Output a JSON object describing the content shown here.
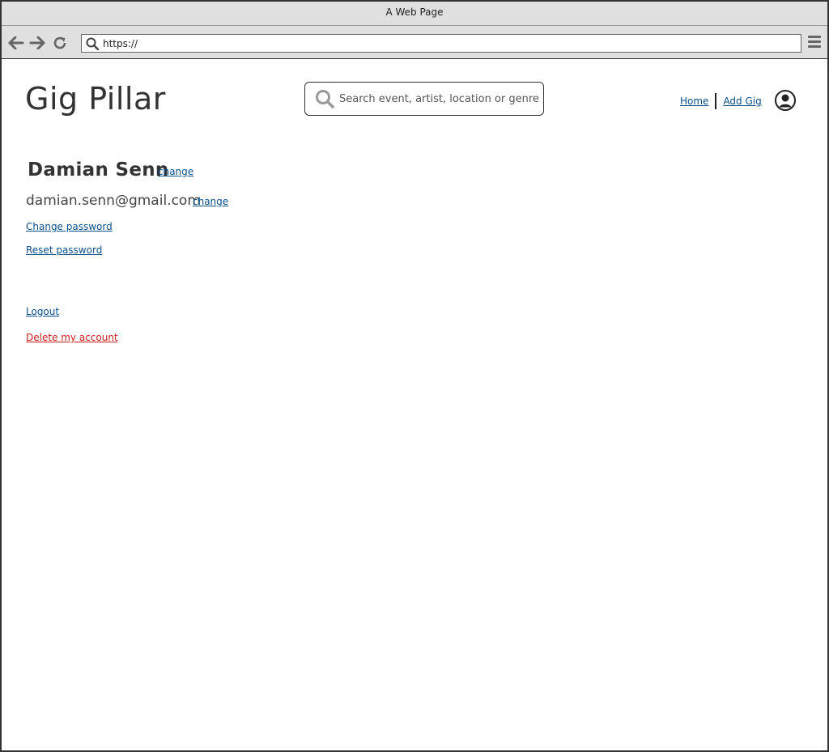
{
  "browser": {
    "window_title": "A Web Page",
    "url": "https://",
    "icons": [
      "back-arrow-icon",
      "forward-arrow-icon",
      "reload-icon",
      "search-icon",
      "hamburger-menu-icon"
    ]
  },
  "header": {
    "logo": "Gig Pillar",
    "search": {
      "placeholder": "Search event, artist, location or genre",
      "icon": "search-icon"
    },
    "nav": {
      "home_label": "Home",
      "add_gig_label": "Add Gig"
    },
    "user_icon": "user-avatar-icon"
  },
  "profile": {
    "name": "Damian Senn",
    "name_change_label": "change",
    "email": "damian.senn@gmail.com",
    "email_change_label": "change",
    "change_password_label": "Change password",
    "reset_password_label": "Reset password",
    "logout_label": "Logout",
    "delete_account_label": "Delete my account"
  },
  "colors": {
    "link": "#0b4f8a",
    "danger": "#cc2222",
    "text": "#333333",
    "chrome": "#e0e0e0"
  }
}
